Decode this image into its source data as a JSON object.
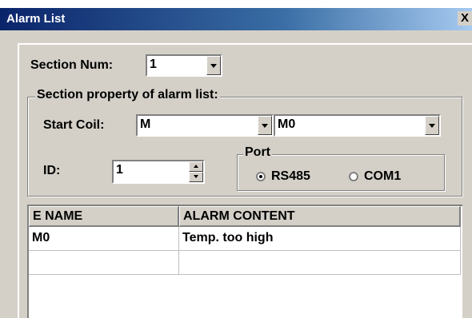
{
  "window": {
    "title": "Alarm List",
    "close_glyph": "X"
  },
  "section": {
    "label": "Section Num:",
    "value": "1"
  },
  "property_group": {
    "legend": "Section property of alarm list:",
    "start_coil_label": "Start Coil:",
    "start_coil_type": "M",
    "start_coil_address": "M0",
    "id_label": "ID:",
    "id_value": "1"
  },
  "port": {
    "legend": "Port",
    "options": [
      {
        "label": "RS485",
        "checked": true
      },
      {
        "label": "COM1",
        "checked": false
      }
    ]
  },
  "table": {
    "columns": [
      "E NAME",
      "ALARM CONTENT"
    ],
    "rows": [
      [
        "M0",
        "Temp. too high"
      ],
      [
        "",
        ""
      ]
    ]
  },
  "icons": {
    "dropdown": "chevron-down-icon",
    "spin_up": "arrow-up-icon",
    "spin_down": "arrow-down-icon",
    "close": "close-icon"
  },
  "colors": {
    "title_gradient_start": "#0a246a",
    "title_gradient_end": "#a6caf0",
    "dialog_face": "#d4d0c8"
  }
}
